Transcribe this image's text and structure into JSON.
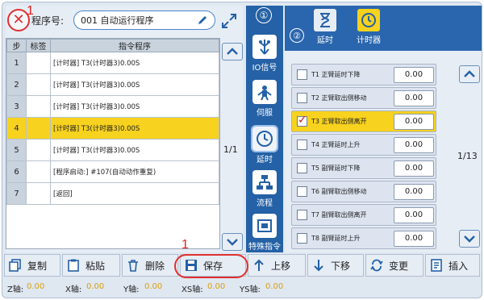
{
  "left": {
    "program_label": "程序号:",
    "program_value": "001 自动运行程序",
    "mark_top": "1",
    "columns": [
      "步",
      "标签",
      "指令程序"
    ],
    "rows": [
      {
        "num": "1",
        "tag": "",
        "cmd": "[计时器] T3(计时器3)0.00S"
      },
      {
        "num": "2",
        "tag": "",
        "cmd": "[计时器] T3(计时器3)0.00S"
      },
      {
        "num": "3",
        "tag": "",
        "cmd": "[计时器] T3(计时器3)0.00S"
      },
      {
        "num": "4",
        "tag": "",
        "cmd": "[计时器] T3(计时器3)0.00S"
      },
      {
        "num": "5",
        "tag": "",
        "cmd": "[计时器] T3(计时器3)0.00S"
      },
      {
        "num": "6",
        "tag": "",
        "cmd": "[程序启动:] #107(自动动作重复)"
      },
      {
        "num": "7",
        "tag": "",
        "cmd": "[返回]"
      }
    ],
    "selected_row": 4,
    "page": "1/1"
  },
  "midbar": {
    "number": "①",
    "items": [
      {
        "label": "IO信号",
        "icon": "io-signal-icon"
      },
      {
        "label": "伺服",
        "icon": "servo-icon"
      },
      {
        "label": "延时",
        "icon": "delay-clock-icon"
      },
      {
        "label": "流程",
        "icon": "flow-icon"
      },
      {
        "label": "特殊指令",
        "icon": "special-command-icon"
      }
    ]
  },
  "right": {
    "number": "②",
    "tabs": [
      {
        "label": "延时",
        "icon": "hourglass-icon"
      },
      {
        "label": "计时器",
        "icon": "timer-clock-icon"
      }
    ],
    "timers": [
      {
        "name": "T1  正臂延时下降",
        "value": "0.00",
        "checked": false
      },
      {
        "name": "T2  正臂取出侧移动",
        "value": "0.00",
        "checked": false
      },
      {
        "name": "T3  正臂取出侧离开",
        "value": "0.00",
        "checked": true
      },
      {
        "name": "T4  正臂延时上升",
        "value": "0.00",
        "checked": false
      },
      {
        "name": "T5  副臂延时下降",
        "value": "0.00",
        "checked": false
      },
      {
        "name": "T6  副臂取出侧移动",
        "value": "0.00",
        "checked": false
      },
      {
        "name": "T7  副臂取出侧离开",
        "value": "0.00",
        "checked": false
      },
      {
        "name": "T8  副臂延时上升",
        "value": "0.00",
        "checked": false
      }
    ],
    "page": "1/13"
  },
  "toolbar": {
    "mark": "1",
    "buttons": [
      {
        "label": "复制",
        "icon": "copy-icon"
      },
      {
        "label": "粘贴",
        "icon": "paste-icon"
      },
      {
        "label": "删除",
        "icon": "delete-icon"
      },
      {
        "label": "保存",
        "icon": "save-icon"
      },
      {
        "label": "上移",
        "icon": "arrow-up-icon"
      },
      {
        "label": "下移",
        "icon": "arrow-down-icon"
      },
      {
        "label": "变更",
        "icon": "change-icon"
      },
      {
        "label": "插入",
        "icon": "insert-icon"
      }
    ]
  },
  "status": {
    "z_label": "Z轴:",
    "z_value": "0.00",
    "x_label": "X轴:",
    "x_value": "0.00",
    "y_label": "Y轴:",
    "y_value": "0.00",
    "xs_label": "XS轴:",
    "xs_value": "0.00",
    "ys_label": "YS轴:",
    "ys_value": "0.00"
  },
  "colors": {
    "accent": "#2461a6",
    "highlight": "#f7d21e",
    "annotation": "#e03030"
  }
}
